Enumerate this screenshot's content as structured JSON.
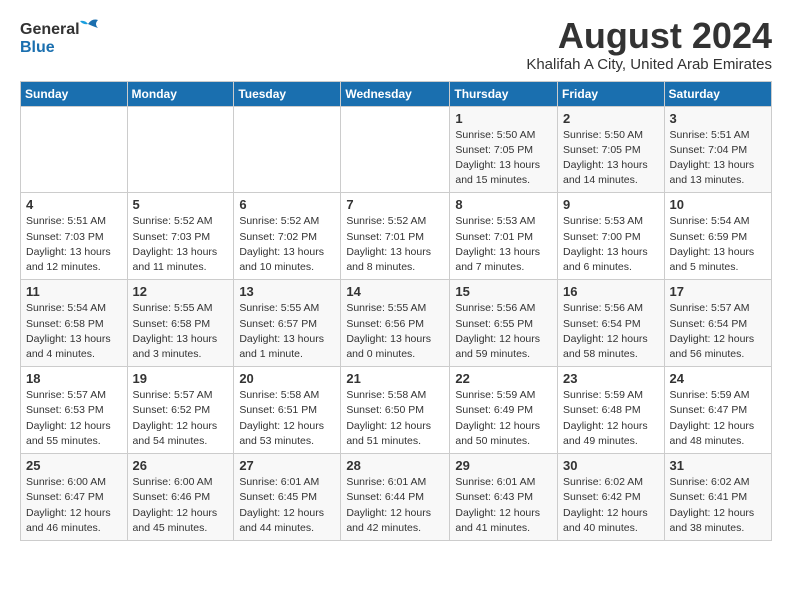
{
  "header": {
    "logo_general": "General",
    "logo_blue": "Blue",
    "title": "August 2024",
    "location": "Khalifah A City, United Arab Emirates"
  },
  "days_of_week": [
    "Sunday",
    "Monday",
    "Tuesday",
    "Wednesday",
    "Thursday",
    "Friday",
    "Saturday"
  ],
  "weeks": [
    [
      {
        "day": "",
        "info": ""
      },
      {
        "day": "",
        "info": ""
      },
      {
        "day": "",
        "info": ""
      },
      {
        "day": "",
        "info": ""
      },
      {
        "day": "1",
        "info": "Sunrise: 5:50 AM\nSunset: 7:05 PM\nDaylight: 13 hours\nand 15 minutes."
      },
      {
        "day": "2",
        "info": "Sunrise: 5:50 AM\nSunset: 7:05 PM\nDaylight: 13 hours\nand 14 minutes."
      },
      {
        "day": "3",
        "info": "Sunrise: 5:51 AM\nSunset: 7:04 PM\nDaylight: 13 hours\nand 13 minutes."
      }
    ],
    [
      {
        "day": "4",
        "info": "Sunrise: 5:51 AM\nSunset: 7:03 PM\nDaylight: 13 hours\nand 12 minutes."
      },
      {
        "day": "5",
        "info": "Sunrise: 5:52 AM\nSunset: 7:03 PM\nDaylight: 13 hours\nand 11 minutes."
      },
      {
        "day": "6",
        "info": "Sunrise: 5:52 AM\nSunset: 7:02 PM\nDaylight: 13 hours\nand 10 minutes."
      },
      {
        "day": "7",
        "info": "Sunrise: 5:52 AM\nSunset: 7:01 PM\nDaylight: 13 hours\nand 8 minutes."
      },
      {
        "day": "8",
        "info": "Sunrise: 5:53 AM\nSunset: 7:01 PM\nDaylight: 13 hours\nand 7 minutes."
      },
      {
        "day": "9",
        "info": "Sunrise: 5:53 AM\nSunset: 7:00 PM\nDaylight: 13 hours\nand 6 minutes."
      },
      {
        "day": "10",
        "info": "Sunrise: 5:54 AM\nSunset: 6:59 PM\nDaylight: 13 hours\nand 5 minutes."
      }
    ],
    [
      {
        "day": "11",
        "info": "Sunrise: 5:54 AM\nSunset: 6:58 PM\nDaylight: 13 hours\nand 4 minutes."
      },
      {
        "day": "12",
        "info": "Sunrise: 5:55 AM\nSunset: 6:58 PM\nDaylight: 13 hours\nand 3 minutes."
      },
      {
        "day": "13",
        "info": "Sunrise: 5:55 AM\nSunset: 6:57 PM\nDaylight: 13 hours\nand 1 minute."
      },
      {
        "day": "14",
        "info": "Sunrise: 5:55 AM\nSunset: 6:56 PM\nDaylight: 13 hours\nand 0 minutes."
      },
      {
        "day": "15",
        "info": "Sunrise: 5:56 AM\nSunset: 6:55 PM\nDaylight: 12 hours\nand 59 minutes."
      },
      {
        "day": "16",
        "info": "Sunrise: 5:56 AM\nSunset: 6:54 PM\nDaylight: 12 hours\nand 58 minutes."
      },
      {
        "day": "17",
        "info": "Sunrise: 5:57 AM\nSunset: 6:54 PM\nDaylight: 12 hours\nand 56 minutes."
      }
    ],
    [
      {
        "day": "18",
        "info": "Sunrise: 5:57 AM\nSunset: 6:53 PM\nDaylight: 12 hours\nand 55 minutes."
      },
      {
        "day": "19",
        "info": "Sunrise: 5:57 AM\nSunset: 6:52 PM\nDaylight: 12 hours\nand 54 minutes."
      },
      {
        "day": "20",
        "info": "Sunrise: 5:58 AM\nSunset: 6:51 PM\nDaylight: 12 hours\nand 53 minutes."
      },
      {
        "day": "21",
        "info": "Sunrise: 5:58 AM\nSunset: 6:50 PM\nDaylight: 12 hours\nand 51 minutes."
      },
      {
        "day": "22",
        "info": "Sunrise: 5:59 AM\nSunset: 6:49 PM\nDaylight: 12 hours\nand 50 minutes."
      },
      {
        "day": "23",
        "info": "Sunrise: 5:59 AM\nSunset: 6:48 PM\nDaylight: 12 hours\nand 49 minutes."
      },
      {
        "day": "24",
        "info": "Sunrise: 5:59 AM\nSunset: 6:47 PM\nDaylight: 12 hours\nand 48 minutes."
      }
    ],
    [
      {
        "day": "25",
        "info": "Sunrise: 6:00 AM\nSunset: 6:47 PM\nDaylight: 12 hours\nand 46 minutes."
      },
      {
        "day": "26",
        "info": "Sunrise: 6:00 AM\nSunset: 6:46 PM\nDaylight: 12 hours\nand 45 minutes."
      },
      {
        "day": "27",
        "info": "Sunrise: 6:01 AM\nSunset: 6:45 PM\nDaylight: 12 hours\nand 44 minutes."
      },
      {
        "day": "28",
        "info": "Sunrise: 6:01 AM\nSunset: 6:44 PM\nDaylight: 12 hours\nand 42 minutes."
      },
      {
        "day": "29",
        "info": "Sunrise: 6:01 AM\nSunset: 6:43 PM\nDaylight: 12 hours\nand 41 minutes."
      },
      {
        "day": "30",
        "info": "Sunrise: 6:02 AM\nSunset: 6:42 PM\nDaylight: 12 hours\nand 40 minutes."
      },
      {
        "day": "31",
        "info": "Sunrise: 6:02 AM\nSunset: 6:41 PM\nDaylight: 12 hours\nand 38 minutes."
      }
    ]
  ]
}
